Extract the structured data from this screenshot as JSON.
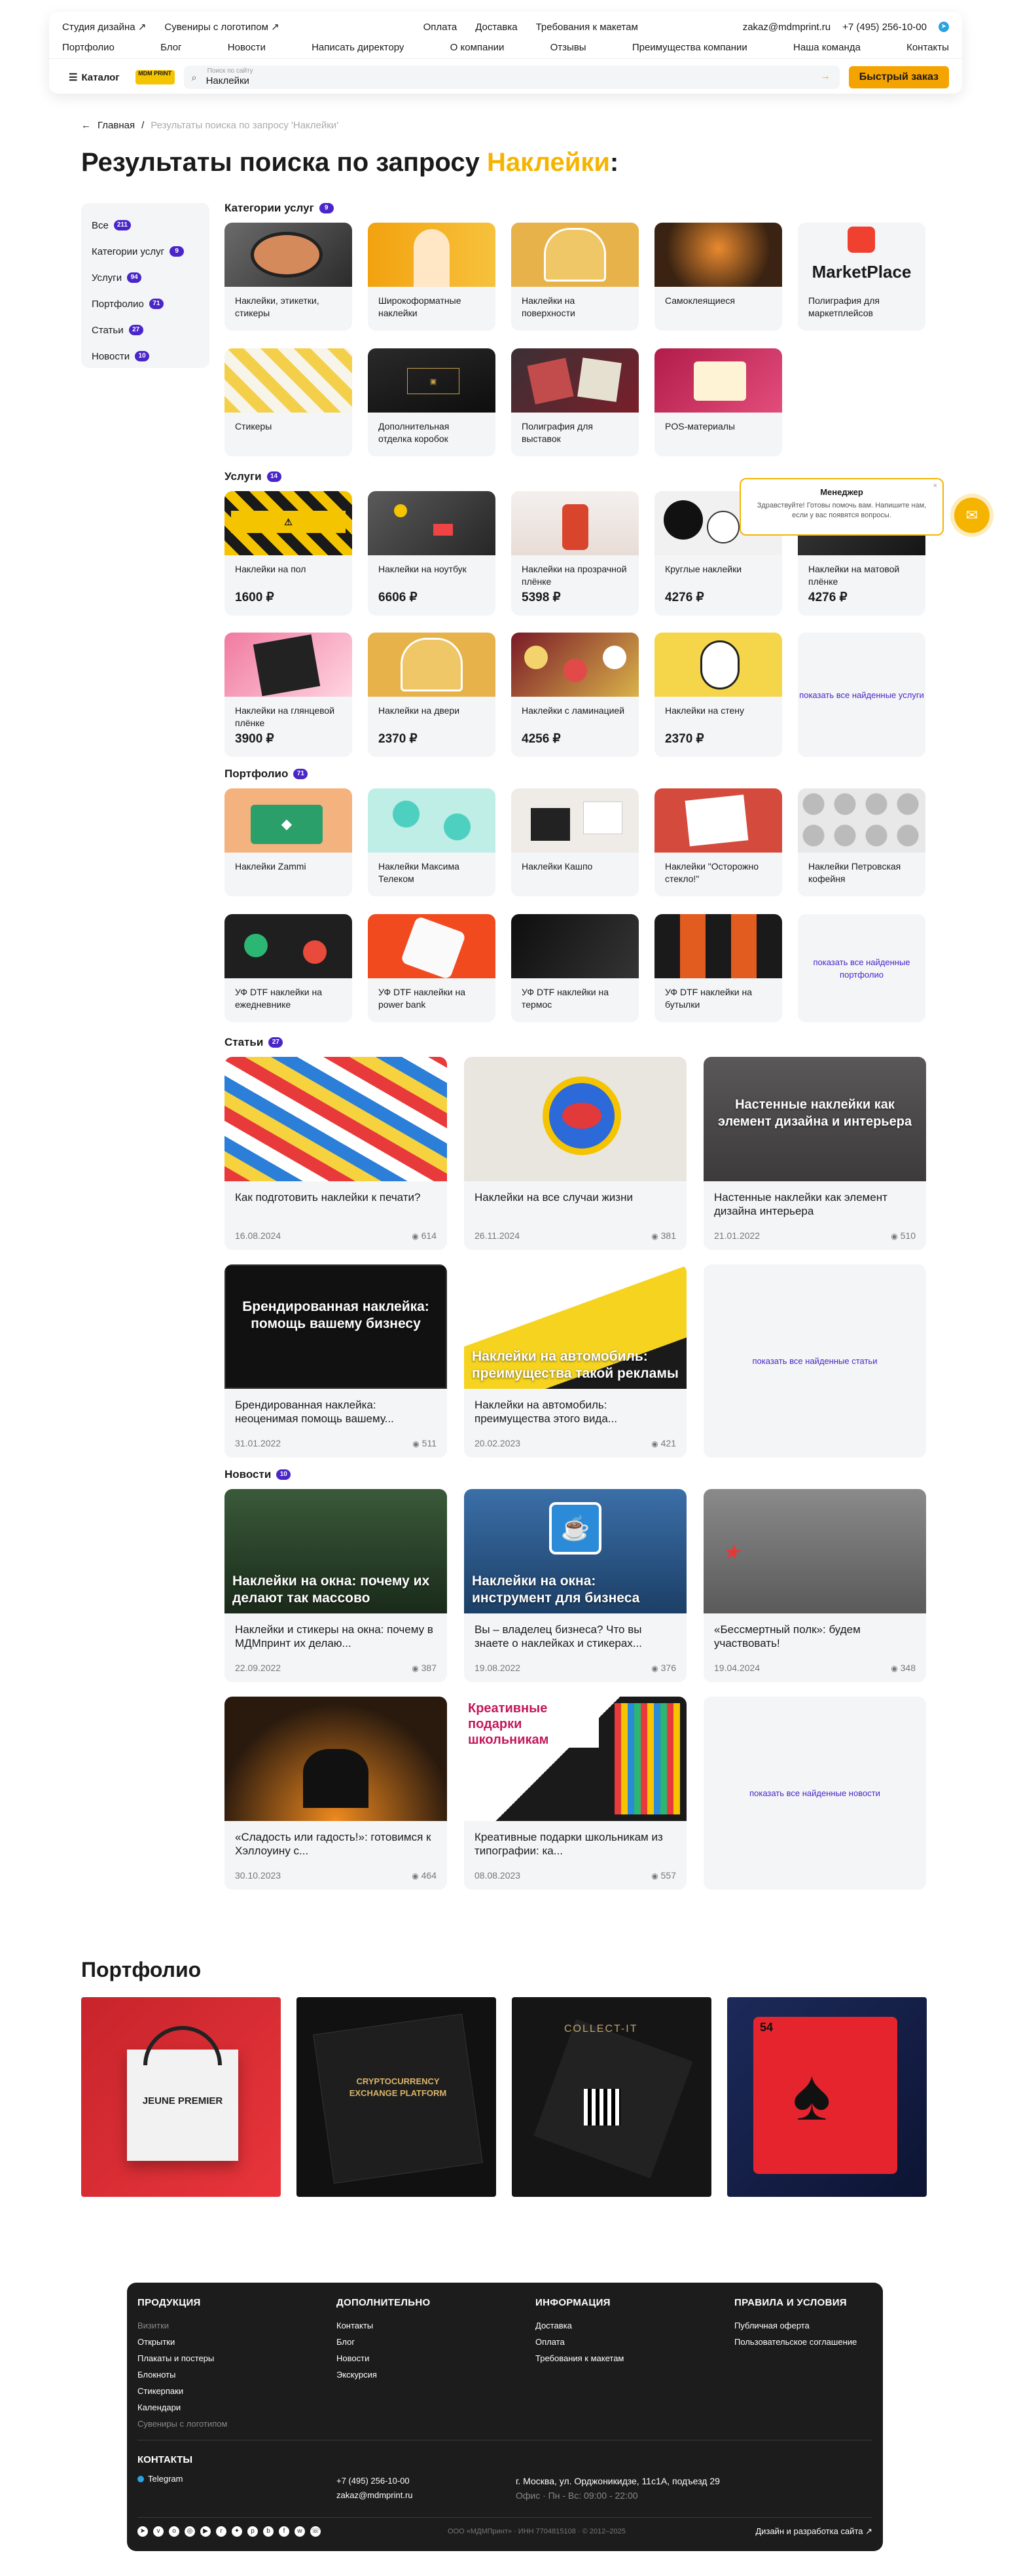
{
  "header": {
    "top_left": [
      "Студия дизайна ↗",
      "Сувениры с логотипом ↗"
    ],
    "top_mid": [
      "Оплата",
      "Доставка",
      "Требования к макетам"
    ],
    "email": "zakaz@mdmprint.ru",
    "phone": "+7 (495) 256-10-00",
    "nav": [
      "Портфолио",
      "Блог",
      "Новости",
      "Написать директору",
      "О компании",
      "Отзывы",
      "Преимущества компании",
      "Наша команда",
      "Контакты"
    ],
    "catalog": "Каталог",
    "logo": "MDM PRINT",
    "search_placeholder": "Поиск по сайту",
    "search_value": "Наклейки",
    "quick_order": "Быстрый заказ"
  },
  "breadcrumb": {
    "home": "Главная",
    "current": "Результаты поиска по запросу 'Наклейки'"
  },
  "title": {
    "prefix": "Результаты поиска по запросу ",
    "query": "Наклейки",
    "suffix": ":"
  },
  "filter": [
    {
      "label": "Все",
      "count": "211"
    },
    {
      "label": "Категории услуг",
      "count": "9"
    },
    {
      "label": "Услуги",
      "count": "94"
    },
    {
      "label": "Портфолио",
      "count": "71"
    },
    {
      "label": "Статьи",
      "count": "27"
    },
    {
      "label": "Новости",
      "count": "10"
    }
  ],
  "sections": {
    "cats": "Категории услуг",
    "cats_count": "9",
    "services": "Услуги",
    "services_count": "14",
    "portfolio": "Портфолио",
    "portfolio_count": "71",
    "articles": "Статьи",
    "articles_count": "27",
    "news": "Новости",
    "news_count": "10"
  },
  "categories": [
    "Наклейки, этикетки, стикеры",
    "Широкоформатные наклейки",
    "Наклейки на поверхности",
    "Самоклеящиеся",
    "Полиграфия для маркетплейсов",
    "Стикеры",
    "Дополнительная отделка коробок",
    "Полиграфия для выставок",
    "POS-материалы"
  ],
  "marketplace_text": "MarketPlace",
  "services": [
    {
      "name": "Наклейки на пол",
      "price": "1600 ₽"
    },
    {
      "name": "Наклейки на ноутбук",
      "price": "6606 ₽"
    },
    {
      "name": "Наклейки на прозрачной плёнке",
      "price": "5398 ₽"
    },
    {
      "name": "Круглые наклейки",
      "price": "4276 ₽"
    },
    {
      "name": "Наклейки на матовой плёнке",
      "price": "4276 ₽"
    },
    {
      "name": "Наклейки на глянцевой плёнке",
      "price": "3900 ₽"
    },
    {
      "name": "Наклейки на двери",
      "price": "2370 ₽"
    },
    {
      "name": "Наклейки с ламинацией",
      "price": "4256 ₽"
    },
    {
      "name": "Наклейки на стену",
      "price": "2370 ₽"
    }
  ],
  "show_all_services": "показать все найденные услуги",
  "portfolio_items": [
    "Наклейки Zammi",
    "Наклейки Максима Телеком",
    "Наклейки Кашпо",
    "Наклейки \"Осторожно стекло!\"",
    "Наклейки Петровская кофейня",
    "УФ DTF наклейки на ежедневнике",
    "УФ DTF наклейки на power bank",
    "УФ DTF наклейки на термос",
    "УФ DTF наклейки на бутылки"
  ],
  "show_all_portfolio": "показать все найденные портфолио",
  "articles": [
    {
      "title": "Как подготовить наклейки к печати?",
      "date": "16.08.2024",
      "views": "614",
      "overlay": ""
    },
    {
      "title": "Наклейки на все случаи жизни",
      "date": "26.11.2024",
      "views": "381",
      "overlay": ""
    },
    {
      "title": "Настенные наклейки как элемент дизайна интерьера",
      "date": "21.01.2022",
      "views": "510",
      "overlay": "Настенные наклейки как элемент дизайна и интерьера"
    },
    {
      "title": "Брендированная наклейка: неоценимая помощь вашему...",
      "date": "31.01.2022",
      "views": "511",
      "overlay": "Брендированная наклейка: помощь вашему бизнесу"
    },
    {
      "title": "Наклейки на автомобиль: преимущества этого вида...",
      "date": "20.02.2023",
      "views": "421",
      "overlay": "Наклейки на автомобиль: преимущества такой рекламы"
    }
  ],
  "show_all_articles": "показать все найденные статьи",
  "news": [
    {
      "title": "Наклейки и стикеры на окна: почему в МДМпринт их делаю...",
      "date": "22.09.2022",
      "views": "387",
      "overlay": "Наклейки на окна: почему их делают так массово"
    },
    {
      "title": "Вы – владелец бизнеса? Что вы знаете о наклейках и стикерах...",
      "date": "19.08.2022",
      "views": "376",
      "overlay": "Наклейки на окна: инструмент для бизнеса"
    },
    {
      "title": "«Бессмертный полк»: будем участвовать!",
      "date": "19.04.2024",
      "views": "348",
      "overlay": ""
    },
    {
      "title": "«Сладость или гадость!»: готовимся к Хэллоуину с...",
      "date": "30.10.2023",
      "views": "464",
      "overlay": ""
    },
    {
      "title": "Креативные подарки школьникам из типографии: ка...",
      "date": "08.08.2023",
      "views": "557",
      "overlay": "Креативные подарки школьникам"
    }
  ],
  "show_all_news": "показать все найденные новости",
  "portfolio_title": "Портфолио",
  "portfolio_gallery": [
    "JEUNE PREMIER",
    "CRYPTOCURRENCY EXCHANGE PLATFORM",
    "COLLECT-IT",
    "54"
  ],
  "chat": {
    "title": "Менеджер",
    "text": "Здравствуйте! Готовы помочь вам. Напишите нам, если у вас появятся вопросы."
  },
  "footer": {
    "col1_title": "ПРОДУКЦИЯ",
    "col1": [
      "Визитки",
      "Открытки",
      "Плакаты и постеры",
      "Блокноты",
      "Стикерпаки",
      "Календари",
      "Сувениры с логотипом"
    ],
    "col2_title": "ДОПОЛНИТЕЛЬНО",
    "col2": [
      "Контакты",
      "Блог",
      "Новости",
      "Экскурсия"
    ],
    "col3_title": "ИНФОРМАЦИЯ",
    "col3": [
      "Доставка",
      "Оплата",
      "Требования к макетам"
    ],
    "col4_title": "ПРАВИЛА И УСЛОВИЯ",
    "col4": [
      "Публичная оферта",
      "Пользовательское соглашение"
    ],
    "contacts_title": "КОНТАКТЫ",
    "telegram": "Telegram",
    "phone": "+7 (495) 256-10-00",
    "email": "zakaz@mdmprint.ru",
    "address": "г. Москва, ул. Орджоникидзе, 11с1А, подъезд 29",
    "hours": "Офис · Пн - Вс: 09:00 - 22:00",
    "legal": "ООО «МДМПринт» · ИНН 7704815108 · © 2012–2025",
    "dev": "Дизайн и разработка сайта ↗"
  },
  "colors": {
    "accent": "#f5b400",
    "badge": "#4a26c9",
    "card_bg": "#f4f5f7",
    "footer_bg": "#1c1c1c"
  }
}
